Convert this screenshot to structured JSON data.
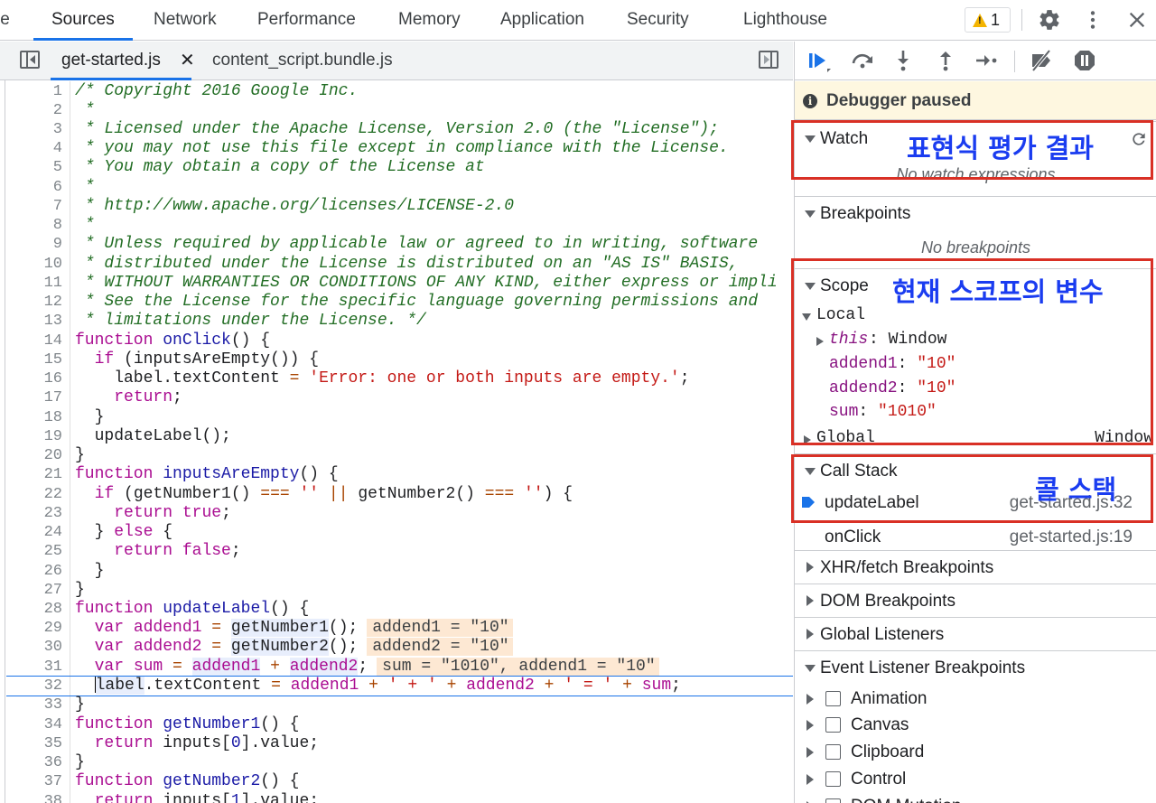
{
  "top_tabs": [
    {
      "label": "le",
      "active": false
    },
    {
      "label": "Sources",
      "active": true
    },
    {
      "label": "Network",
      "active": false
    },
    {
      "label": "Performance",
      "active": false
    },
    {
      "label": "Memory",
      "active": false
    },
    {
      "label": "Application",
      "active": false
    },
    {
      "label": "Security",
      "active": false
    },
    {
      "label": "Lighthouse",
      "active": false
    }
  ],
  "warnings": {
    "count": "1",
    "icon": "warning-icon",
    "color": "#f4b400"
  },
  "top_icons": [
    "gear-icon",
    "kebab-menu-icon",
    "close-icon"
  ],
  "file_tabs": [
    {
      "label": "get-started.js",
      "active": true,
      "closable": true
    },
    {
      "label": "content_script.bundle.js",
      "active": false,
      "closable": false
    }
  ],
  "editor": {
    "current_line": 32,
    "lines": [
      {
        "n": "1"
      },
      {
        "n": "2"
      },
      {
        "n": "3"
      },
      {
        "n": "4"
      },
      {
        "n": "5"
      },
      {
        "n": "6"
      },
      {
        "n": "7"
      },
      {
        "n": "8"
      },
      {
        "n": "9"
      },
      {
        "n": "10"
      },
      {
        "n": "11"
      },
      {
        "n": "12"
      },
      {
        "n": "13"
      },
      {
        "n": "14"
      },
      {
        "n": "15"
      },
      {
        "n": "16"
      },
      {
        "n": "17"
      },
      {
        "n": "18"
      },
      {
        "n": "19"
      },
      {
        "n": "20"
      },
      {
        "n": "21"
      },
      {
        "n": "22"
      },
      {
        "n": "23"
      },
      {
        "n": "24"
      },
      {
        "n": "25"
      },
      {
        "n": "26"
      },
      {
        "n": "27"
      },
      {
        "n": "28"
      },
      {
        "n": "29"
      },
      {
        "n": "30"
      },
      {
        "n": "31"
      },
      {
        "n": "32"
      },
      {
        "n": "33"
      },
      {
        "n": "34"
      },
      {
        "n": "35"
      },
      {
        "n": "36"
      },
      {
        "n": "37"
      },
      {
        "n": "38"
      }
    ],
    "tokens": {
      "l1": "/* Copyright 2016 Google Inc.",
      "l2": " *",
      "l3": " * Licensed under the Apache License, Version 2.0 (the \"License\");",
      "l4": " * you may not use this file except in compliance with the License.",
      "l5": " * You may obtain a copy of the License at",
      "l6": " *",
      "l7": " * http://www.apache.org/licenses/LICENSE-2.0",
      "l8": " *",
      "l9": " * Unless required by applicable law or agreed to in writing, software",
      "l10": " * distributed under the License is distributed on an \"AS IS\" BASIS,",
      "l11": " * WITHOUT WARRANTIES OR CONDITIONS OF ANY KIND, either express or impli",
      "l12": " * See the License for the specific language governing permissions and",
      "l13": " * limitations under the License. */",
      "kw_function": "function",
      "kw_if": "if",
      "kw_return": "return",
      "kw_else": "else",
      "kw_var": "var",
      "kw_true": "true",
      "kw_false": "false",
      "fn_onClick": "onClick",
      "fn_inputsAreEmpty": "inputsAreEmpty",
      "fn_updateLabel": "updateLabel",
      "fn_getNumber1": "getNumber1",
      "fn_getNumber2": "getNumber2",
      "v_addend1": "addend1",
      "v_addend2": "addend2",
      "v_sum": "sum",
      "str_error": "'Error: one or both inputs are empty.'",
      "str_empty": "''",
      "str_plus": "' + '",
      "str_eq": "' = '",
      "iv_29": "addend1 = \"10\"",
      "iv_30": "addend2 = \"10\"",
      "iv_31": "sum = \"1010\", addend1 = \"10\""
    }
  },
  "debugger": {
    "toolbar_icons": [
      "resume-icon",
      "step-over-icon",
      "step-into-icon",
      "step-out-icon",
      "step-icon",
      "deactivate-breakpoints-icon",
      "pause-on-exceptions-icon"
    ],
    "paused_label": "Debugger paused",
    "sections": {
      "watch": {
        "label": "Watch",
        "empty": "No watch expressions"
      },
      "breakpoints": {
        "label": "Breakpoints",
        "empty": "No breakpoints"
      },
      "scope": {
        "label": "Scope",
        "local_label": "Local",
        "this_label": "this",
        "this_value": "Window",
        "vars": [
          {
            "name": "addend1",
            "value": "\"10\""
          },
          {
            "name": "addend2",
            "value": "\"10\""
          },
          {
            "name": "sum",
            "value": "\"1010\""
          }
        ],
        "global_label": "Global",
        "global_value": "Window"
      },
      "call_stack": {
        "label": "Call Stack",
        "frames": [
          {
            "fn": "updateLabel",
            "loc": "get-started.js:32",
            "current": true
          },
          {
            "fn": "onClick",
            "loc": "get-started.js:19",
            "current": false
          }
        ]
      },
      "xhr": {
        "label": "XHR/fetch Breakpoints"
      },
      "dom": {
        "label": "DOM Breakpoints"
      },
      "global_listeners": {
        "label": "Global Listeners"
      },
      "event_listeners": {
        "label": "Event Listener Breakpoints",
        "items": [
          "Animation",
          "Canvas",
          "Clipboard",
          "Control",
          "DOM Mutation"
        ]
      }
    }
  },
  "annotations": {
    "watch": "표현식 평가 결과",
    "scope": "현재 스코프의 변수",
    "call_stack": "콜 스택",
    "color_box": "#d93025",
    "color_text": "#1a3cf0"
  }
}
